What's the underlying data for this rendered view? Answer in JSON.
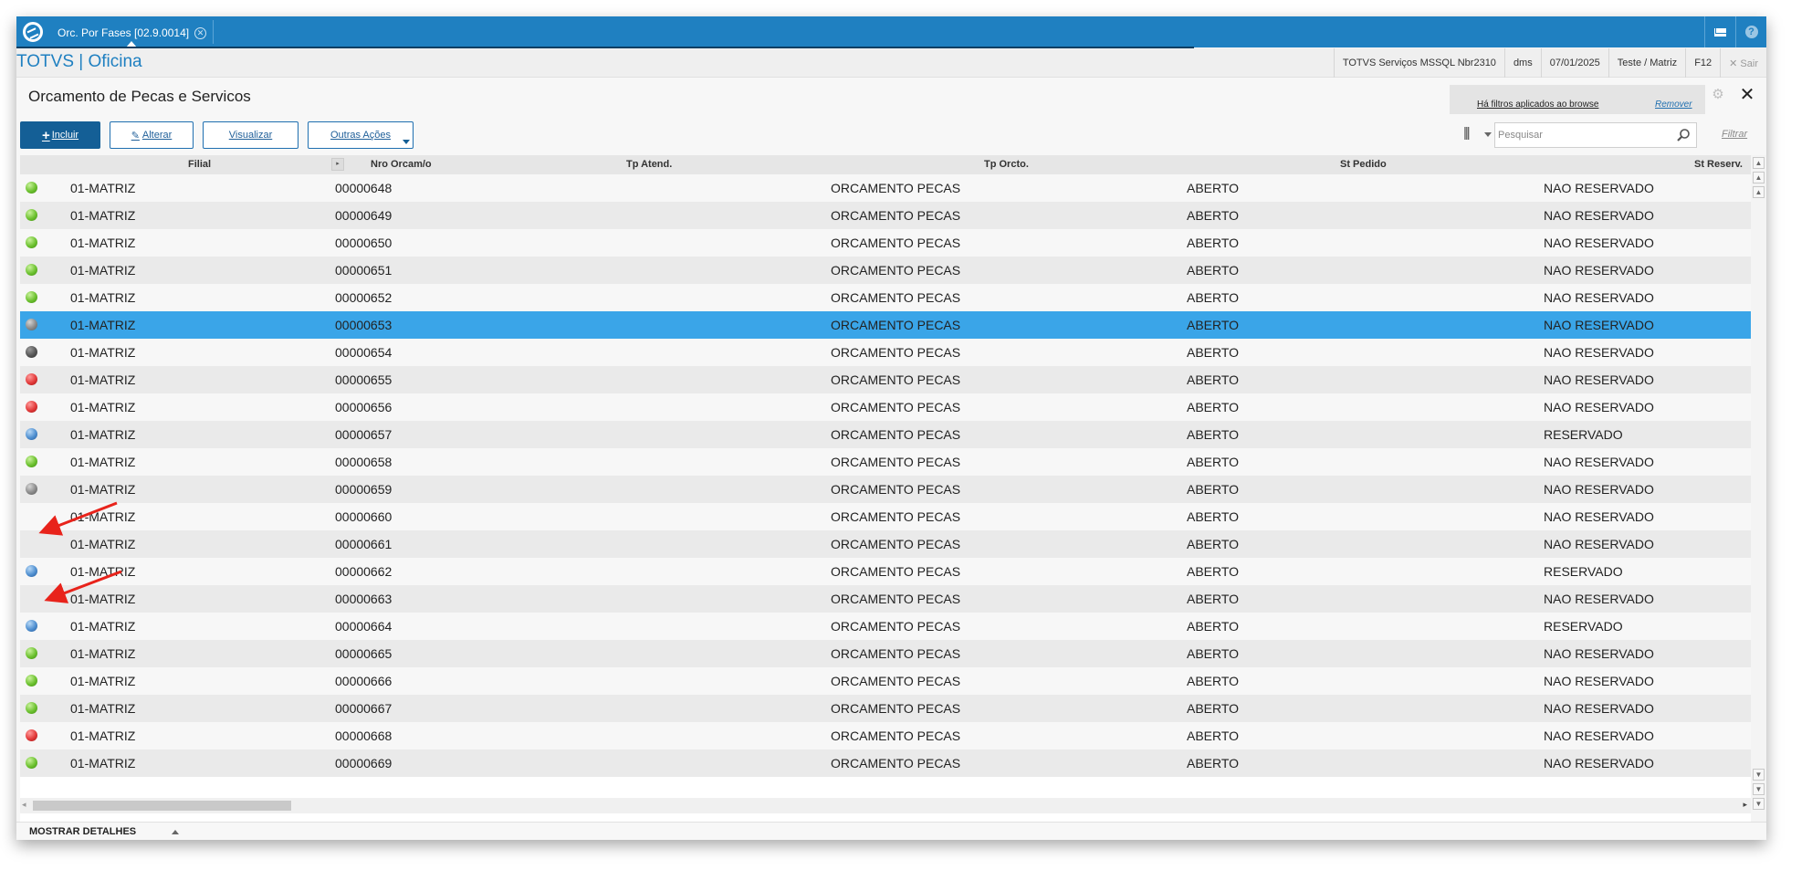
{
  "tab": {
    "title": "Orc. Por Fases [02.9.0014]",
    "close": "✕"
  },
  "header": {
    "brand": "TOTVS | Oficina",
    "cells": [
      "TOTVS Serviços MSSQL Nbr2310",
      "dms",
      "07/01/2025",
      "Teste / Matriz",
      "F12"
    ],
    "sair": "✕  Sair"
  },
  "panel": {
    "title": "Orcamento de Pecas e Servicos",
    "filter_notice": "Há filtros aplicados ao browse",
    "filter_remove": "Remover",
    "close_glyph": "✕",
    "settings_glyph": "⚙"
  },
  "toolbar": {
    "incluir_icon": "+",
    "incluir": "Incluir",
    "alterar_icon": "✎",
    "alterar": "Alterar",
    "visualizar": "Visualizar",
    "outras": "Outras Ações",
    "columns_glyph": "|||",
    "search_placeholder": "Pesquisar",
    "filtrar": "Filtrar"
  },
  "grid": {
    "columns": {
      "filial": "Filial",
      "sort_glyph": "▸",
      "nro": "Nro Orcam/o",
      "tp_atend": "Tp Atend.",
      "tp_orcto": "Tp Orcto.",
      "st_pedido": "St Pedido",
      "st_reserv": "St Reserv."
    },
    "selected_index": 5,
    "rows": [
      {
        "status": "green",
        "filial": "01-MATRIZ",
        "nro": "00000648",
        "tp_orcto": "ORCAMENTO PECAS",
        "st_pedido": "ABERTO",
        "st_reserv": "NAO RESERVADO"
      },
      {
        "status": "green",
        "filial": "01-MATRIZ",
        "nro": "00000649",
        "tp_orcto": "ORCAMENTO PECAS",
        "st_pedido": "ABERTO",
        "st_reserv": "NAO RESERVADO"
      },
      {
        "status": "green",
        "filial": "01-MATRIZ",
        "nro": "00000650",
        "tp_orcto": "ORCAMENTO PECAS",
        "st_pedido": "ABERTO",
        "st_reserv": "NAO RESERVADO"
      },
      {
        "status": "green",
        "filial": "01-MATRIZ",
        "nro": "00000651",
        "tp_orcto": "ORCAMENTO PECAS",
        "st_pedido": "ABERTO",
        "st_reserv": "NAO RESERVADO"
      },
      {
        "status": "green",
        "filial": "01-MATRIZ",
        "nro": "00000652",
        "tp_orcto": "ORCAMENTO PECAS",
        "st_pedido": "ABERTO",
        "st_reserv": "NAO RESERVADO"
      },
      {
        "status": "gray",
        "filial": "01-MATRIZ",
        "nro": "00000653",
        "tp_orcto": "ORCAMENTO PECAS",
        "st_pedido": "ABERTO",
        "st_reserv": "NAO RESERVADO"
      },
      {
        "status": "dark",
        "filial": "01-MATRIZ",
        "nro": "00000654",
        "tp_orcto": "ORCAMENTO PECAS",
        "st_pedido": "ABERTO",
        "st_reserv": "NAO RESERVADO"
      },
      {
        "status": "red",
        "filial": "01-MATRIZ",
        "nro": "00000655",
        "tp_orcto": "ORCAMENTO PECAS",
        "st_pedido": "ABERTO",
        "st_reserv": "NAO RESERVADO"
      },
      {
        "status": "red",
        "filial": "01-MATRIZ",
        "nro": "00000656",
        "tp_orcto": "ORCAMENTO PECAS",
        "st_pedido": "ABERTO",
        "st_reserv": "NAO RESERVADO"
      },
      {
        "status": "blue",
        "filial": "01-MATRIZ",
        "nro": "00000657",
        "tp_orcto": "ORCAMENTO PECAS",
        "st_pedido": "ABERTO",
        "st_reserv": "RESERVADO"
      },
      {
        "status": "green",
        "filial": "01-MATRIZ",
        "nro": "00000658",
        "tp_orcto": "ORCAMENTO PECAS",
        "st_pedido": "ABERTO",
        "st_reserv": "NAO RESERVADO"
      },
      {
        "status": "gray",
        "filial": "01-MATRIZ",
        "nro": "00000659",
        "tp_orcto": "ORCAMENTO PECAS",
        "st_pedido": "ABERTO",
        "st_reserv": "NAO RESERVADO"
      },
      {
        "status": "none",
        "filial": "01-MATRIZ",
        "nro": "00000660",
        "tp_orcto": "ORCAMENTO PECAS",
        "st_pedido": "ABERTO",
        "st_reserv": "NAO RESERVADO"
      },
      {
        "status": "none",
        "filial": "01-MATRIZ",
        "nro": "00000661",
        "tp_orcto": "ORCAMENTO PECAS",
        "st_pedido": "ABERTO",
        "st_reserv": "NAO RESERVADO"
      },
      {
        "status": "blue",
        "filial": "01-MATRIZ",
        "nro": "00000662",
        "tp_orcto": "ORCAMENTO PECAS",
        "st_pedido": "ABERTO",
        "st_reserv": "RESERVADO"
      },
      {
        "status": "none",
        "filial": "01-MATRIZ",
        "nro": "00000663",
        "tp_orcto": "ORCAMENTO PECAS",
        "st_pedido": "ABERTO",
        "st_reserv": "NAO RESERVADO"
      },
      {
        "status": "blue",
        "filial": "01-MATRIZ",
        "nro": "00000664",
        "tp_orcto": "ORCAMENTO PECAS",
        "st_pedido": "ABERTO",
        "st_reserv": "RESERVADO"
      },
      {
        "status": "green",
        "filial": "01-MATRIZ",
        "nro": "00000665",
        "tp_orcto": "ORCAMENTO PECAS",
        "st_pedido": "ABERTO",
        "st_reserv": "NAO RESERVADO"
      },
      {
        "status": "green",
        "filial": "01-MATRIZ",
        "nro": "00000666",
        "tp_orcto": "ORCAMENTO PECAS",
        "st_pedido": "ABERTO",
        "st_reserv": "NAO RESERVADO"
      },
      {
        "status": "green",
        "filial": "01-MATRIZ",
        "nro": "00000667",
        "tp_orcto": "ORCAMENTO PECAS",
        "st_pedido": "ABERTO",
        "st_reserv": "NAO RESERVADO"
      },
      {
        "status": "red",
        "filial": "01-MATRIZ",
        "nro": "00000668",
        "tp_orcto": "ORCAMENTO PECAS",
        "st_pedido": "ABERTO",
        "st_reserv": "NAO RESERVADO"
      },
      {
        "status": "green",
        "filial": "01-MATRIZ",
        "nro": "00000669",
        "tp_orcto": "ORCAMENTO PECAS",
        "st_pedido": "ABERTO",
        "st_reserv": "NAO RESERVADO"
      }
    ]
  },
  "details": {
    "label": "MOSTRAR DETALHES"
  },
  "colors": {
    "brand": "#1f80c1",
    "selected_row": "#3aa5e8",
    "annotation_arrow": "#e8231b"
  }
}
